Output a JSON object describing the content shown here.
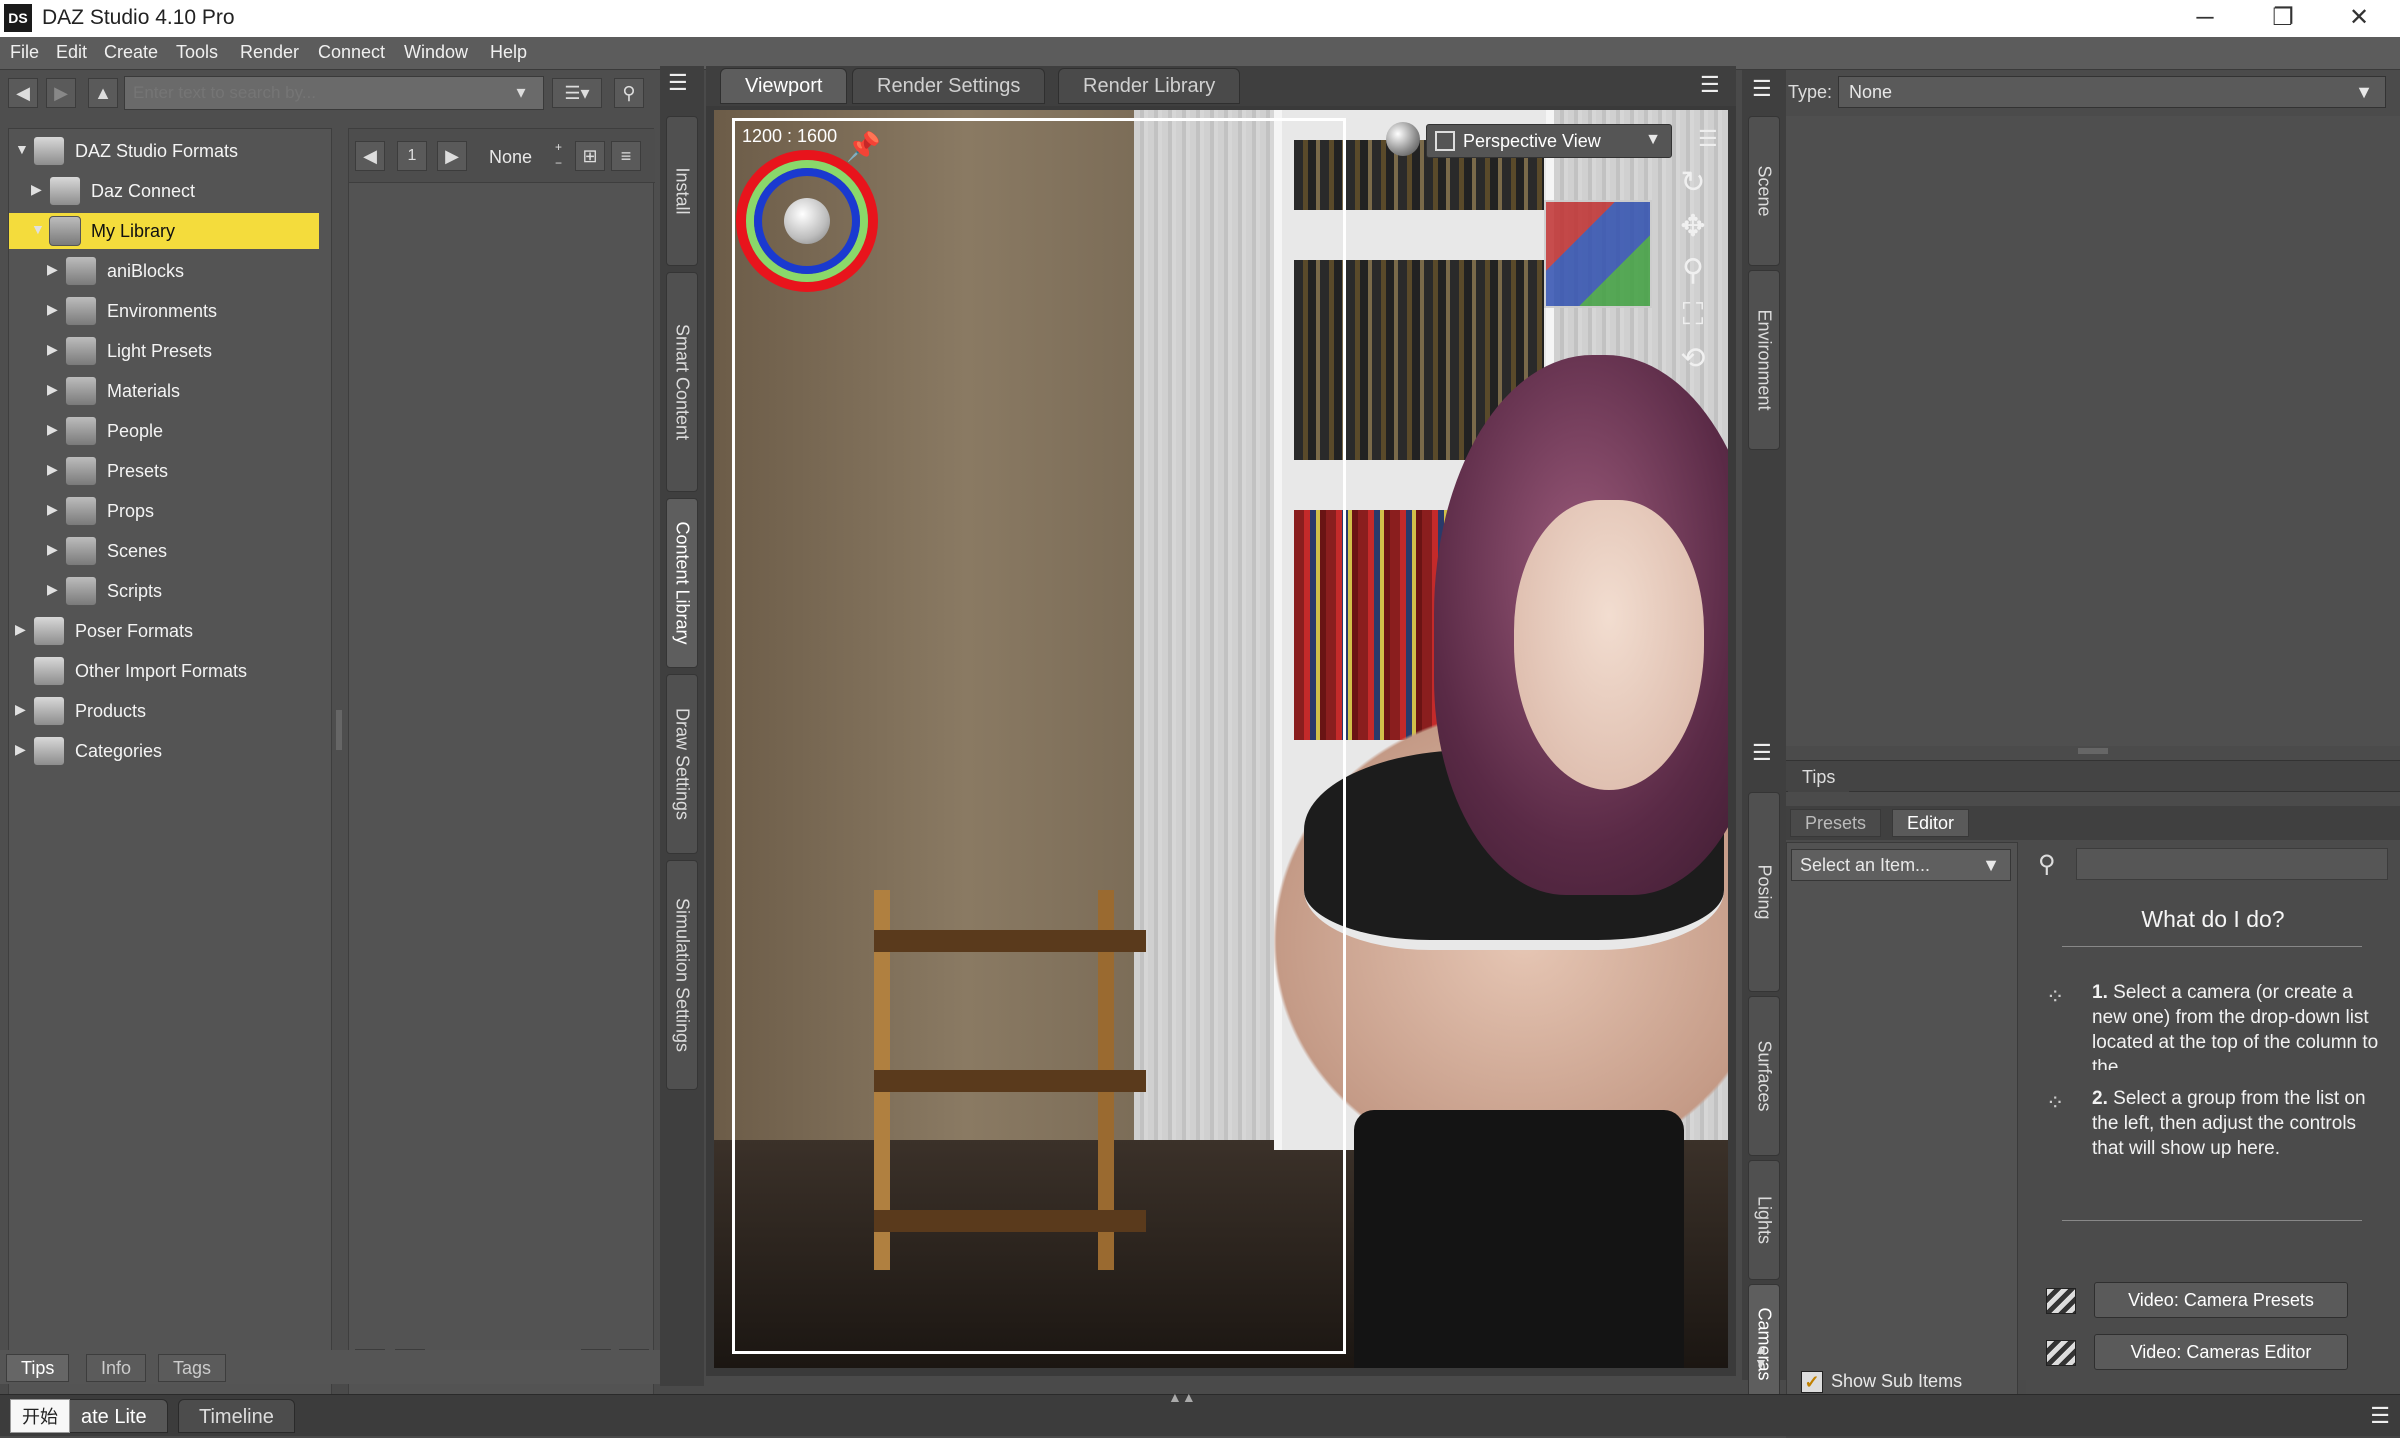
{
  "window": {
    "title": "DAZ Studio 4.10 Pro",
    "logo": "DS",
    "controls": {
      "minimize": "─",
      "restore": "❐",
      "close": "✕"
    }
  },
  "menu": [
    "File",
    "Edit",
    "Create",
    "Tools",
    "Render",
    "Connect",
    "Window",
    "Help"
  ],
  "search": {
    "placeholder": "Enter text to search by..."
  },
  "tree": [
    {
      "label": "DAZ Studio Formats",
      "level": 0,
      "expanded": true,
      "icon": "database-icon"
    },
    {
      "label": "Daz Connect",
      "level": 1,
      "expanded": false,
      "icon": "daz-connect-icon"
    },
    {
      "label": "My Library",
      "level": 1,
      "expanded": true,
      "selected": true,
      "icon": "folder-icon"
    },
    {
      "label": "aniBlocks",
      "level": 2,
      "icon": "folder-icon"
    },
    {
      "label": "Environments",
      "level": 2,
      "icon": "folder-icon"
    },
    {
      "label": "Light Presets",
      "level": 2,
      "icon": "folder-icon"
    },
    {
      "label": "Materials",
      "level": 2,
      "icon": "folder-icon"
    },
    {
      "label": "People",
      "level": 2,
      "icon": "folder-icon"
    },
    {
      "label": "Presets",
      "level": 2,
      "icon": "folder-icon"
    },
    {
      "label": "Props",
      "level": 2,
      "icon": "folder-icon"
    },
    {
      "label": "Scenes",
      "level": 2,
      "icon": "folder-icon"
    },
    {
      "label": "Scripts",
      "level": 2,
      "icon": "folder-icon"
    },
    {
      "label": "Poser Formats",
      "level": 0,
      "icon": "database-icon"
    },
    {
      "label": "Other Import Formats",
      "level": 0,
      "noarrow": true,
      "icon": "database-icon"
    },
    {
      "label": "Products",
      "level": 0,
      "icon": "database-icon"
    },
    {
      "label": "Categories",
      "level": 0,
      "icon": "database-icon"
    }
  ],
  "content_pager": {
    "page": "1",
    "sort": "None"
  },
  "left_bottom_tabs": [
    "Tips",
    "Info",
    "Tags"
  ],
  "left_vtabs": [
    "Install",
    "Smart Content",
    "Content Library",
    "Draw Settings",
    "Simulation Settings"
  ],
  "viewport": {
    "tabs": [
      "Viewport",
      "Render Settings",
      "Render Library"
    ],
    "frame_size": "1200 : 1600",
    "camera": "Perspective View"
  },
  "right_vtabs_top": [
    "Scene",
    "Environment"
  ],
  "right_vtabs_bottom": [
    "Posing",
    "Surfaces",
    "Lights",
    "Cameras"
  ],
  "type_bar": {
    "label": "Type:",
    "value": "None"
  },
  "tips_label": "Tips",
  "pe_tabs": [
    "Presets",
    "Editor"
  ],
  "select_item": "Select an Item...",
  "what_heading": "What do I do?",
  "steps": [
    {
      "num": "1.",
      "text": "Select a camera (or create a new one) from the drop-down list located at the top of the column to the"
    },
    {
      "num": "2.",
      "text": "Select a group from the list on the left, then adjust the controls that will show up here."
    }
  ],
  "videos": [
    "Video: Camera Presets",
    "Video: Cameras Editor"
  ],
  "show_sub": "Show Sub Items",
  "bottom": {
    "start": "开始",
    "tabs": [
      "ate Lite",
      "Timeline"
    ]
  }
}
